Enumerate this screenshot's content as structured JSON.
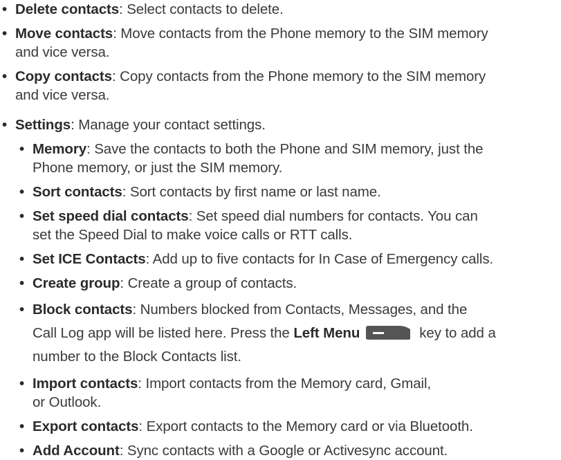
{
  "top_items": [
    {
      "term": "Delete contacts",
      "desc": ": Select contacts to delete."
    },
    {
      "term": "Move contacts",
      "desc": ": Move contacts from the Phone memory to the SIM memory",
      "desc2": "and vice versa."
    },
    {
      "term": "Copy contacts",
      "desc": ": Copy contacts from the Phone memory to the SIM memory",
      "desc2": "and vice versa."
    }
  ],
  "settings": {
    "term": "Settings",
    "desc": ": Manage your contact settings.",
    "sub_items": [
      {
        "term": "Memory",
        "desc": ": Save the contacts to both the Phone and SIM memory, just the",
        "desc2": "Phone memory, or just the SIM memory."
      },
      {
        "term": "Sort contacts",
        "desc": ": Sort contacts by first name or last name."
      },
      {
        "term": "Set speed dial contacts",
        "desc": ": Set speed dial numbers for contacts. You can",
        "desc2": "set the Speed Dial to make voice calls or RTT calls."
      },
      {
        "term": "Set ICE Contacts",
        "desc": ": Add up to five contacts for In Case of Emergency calls."
      },
      {
        "term": "Create group",
        "desc": ": Create a group of contacts."
      },
      {
        "term": "Block contacts",
        "desc": ": Numbers blocked from Contacts, Messages, and the",
        "desc2a": "Call Log app will be listed here. Press the ",
        "desc2_bold": "Left Menu",
        "desc2b": "key to add a",
        "desc3": "number to the Block Contacts list."
      },
      {
        "term": "Import contacts",
        "desc": ": Import contacts from the Memory card, Gmail,",
        "desc2": "or Outlook."
      },
      {
        "term": "Export contacts",
        "desc": ": Export contacts to the Memory card or via Bluetooth."
      },
      {
        "term": "Add Account",
        "desc": ": Sync contacts with a Google or Activesync account."
      }
    ]
  },
  "icons": {
    "left_menu_key": "left-menu-key-icon",
    "bullet": "•"
  },
  "colors": {
    "text": "#3a3a3a",
    "key_fill": "#555555"
  }
}
